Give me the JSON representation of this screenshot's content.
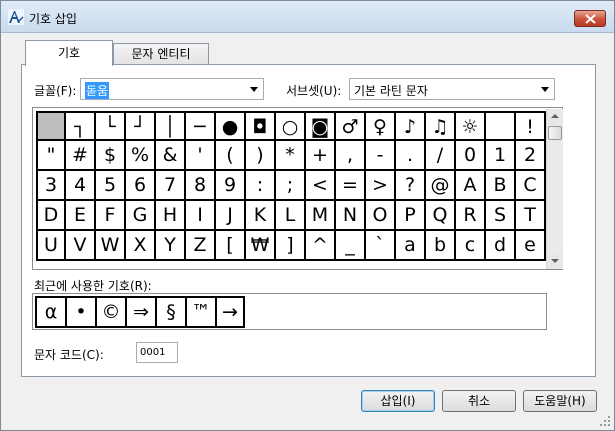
{
  "window": {
    "title": "기호 삽입"
  },
  "tabs": [
    {
      "label": "기호"
    },
    {
      "label": "문자 엔티티"
    }
  ],
  "font": {
    "label": "글꼴(F):",
    "value": "돋움"
  },
  "subset": {
    "label": "서브셋(U):",
    "value": "기본 라틴 문자"
  },
  "symbols": [
    " ",
    "┐",
    "└",
    "┘",
    "│",
    "─",
    "●",
    "◘",
    "○",
    "◙",
    "♂",
    "♀",
    "♪",
    "♫",
    "☼",
    " ",
    "!",
    "\"",
    "#",
    "$",
    "%",
    "&",
    "'",
    "(",
    ")",
    "*",
    "+",
    ",",
    "-",
    ".",
    "/",
    "0",
    "1",
    "2",
    "3",
    "4",
    "5",
    "6",
    "7",
    "8",
    "9",
    ":",
    ";",
    "<",
    "=",
    ">",
    "?",
    "@",
    "A",
    "B",
    "C",
    "D",
    "E",
    "F",
    "G",
    "H",
    "I",
    "J",
    "K",
    "L",
    "M",
    "N",
    "O",
    "P",
    "Q",
    "R",
    "S",
    "T",
    "U",
    "V",
    "W",
    "X",
    "Y",
    "Z",
    "[",
    "₩",
    "]",
    "^",
    "_",
    "`",
    "a",
    "b",
    "c",
    "d",
    "e"
  ],
  "selected_symbol_index": 0,
  "recent": {
    "label": "최근에 사용한 기호(R):",
    "items": [
      "α",
      "•",
      "©",
      "⇒",
      "§",
      "™",
      "→"
    ]
  },
  "char_code": {
    "label": "문자 코드(C):",
    "value": "0001"
  },
  "buttons": {
    "insert": "삽입(I)",
    "cancel": "취소",
    "help": "도움말(H)"
  }
}
